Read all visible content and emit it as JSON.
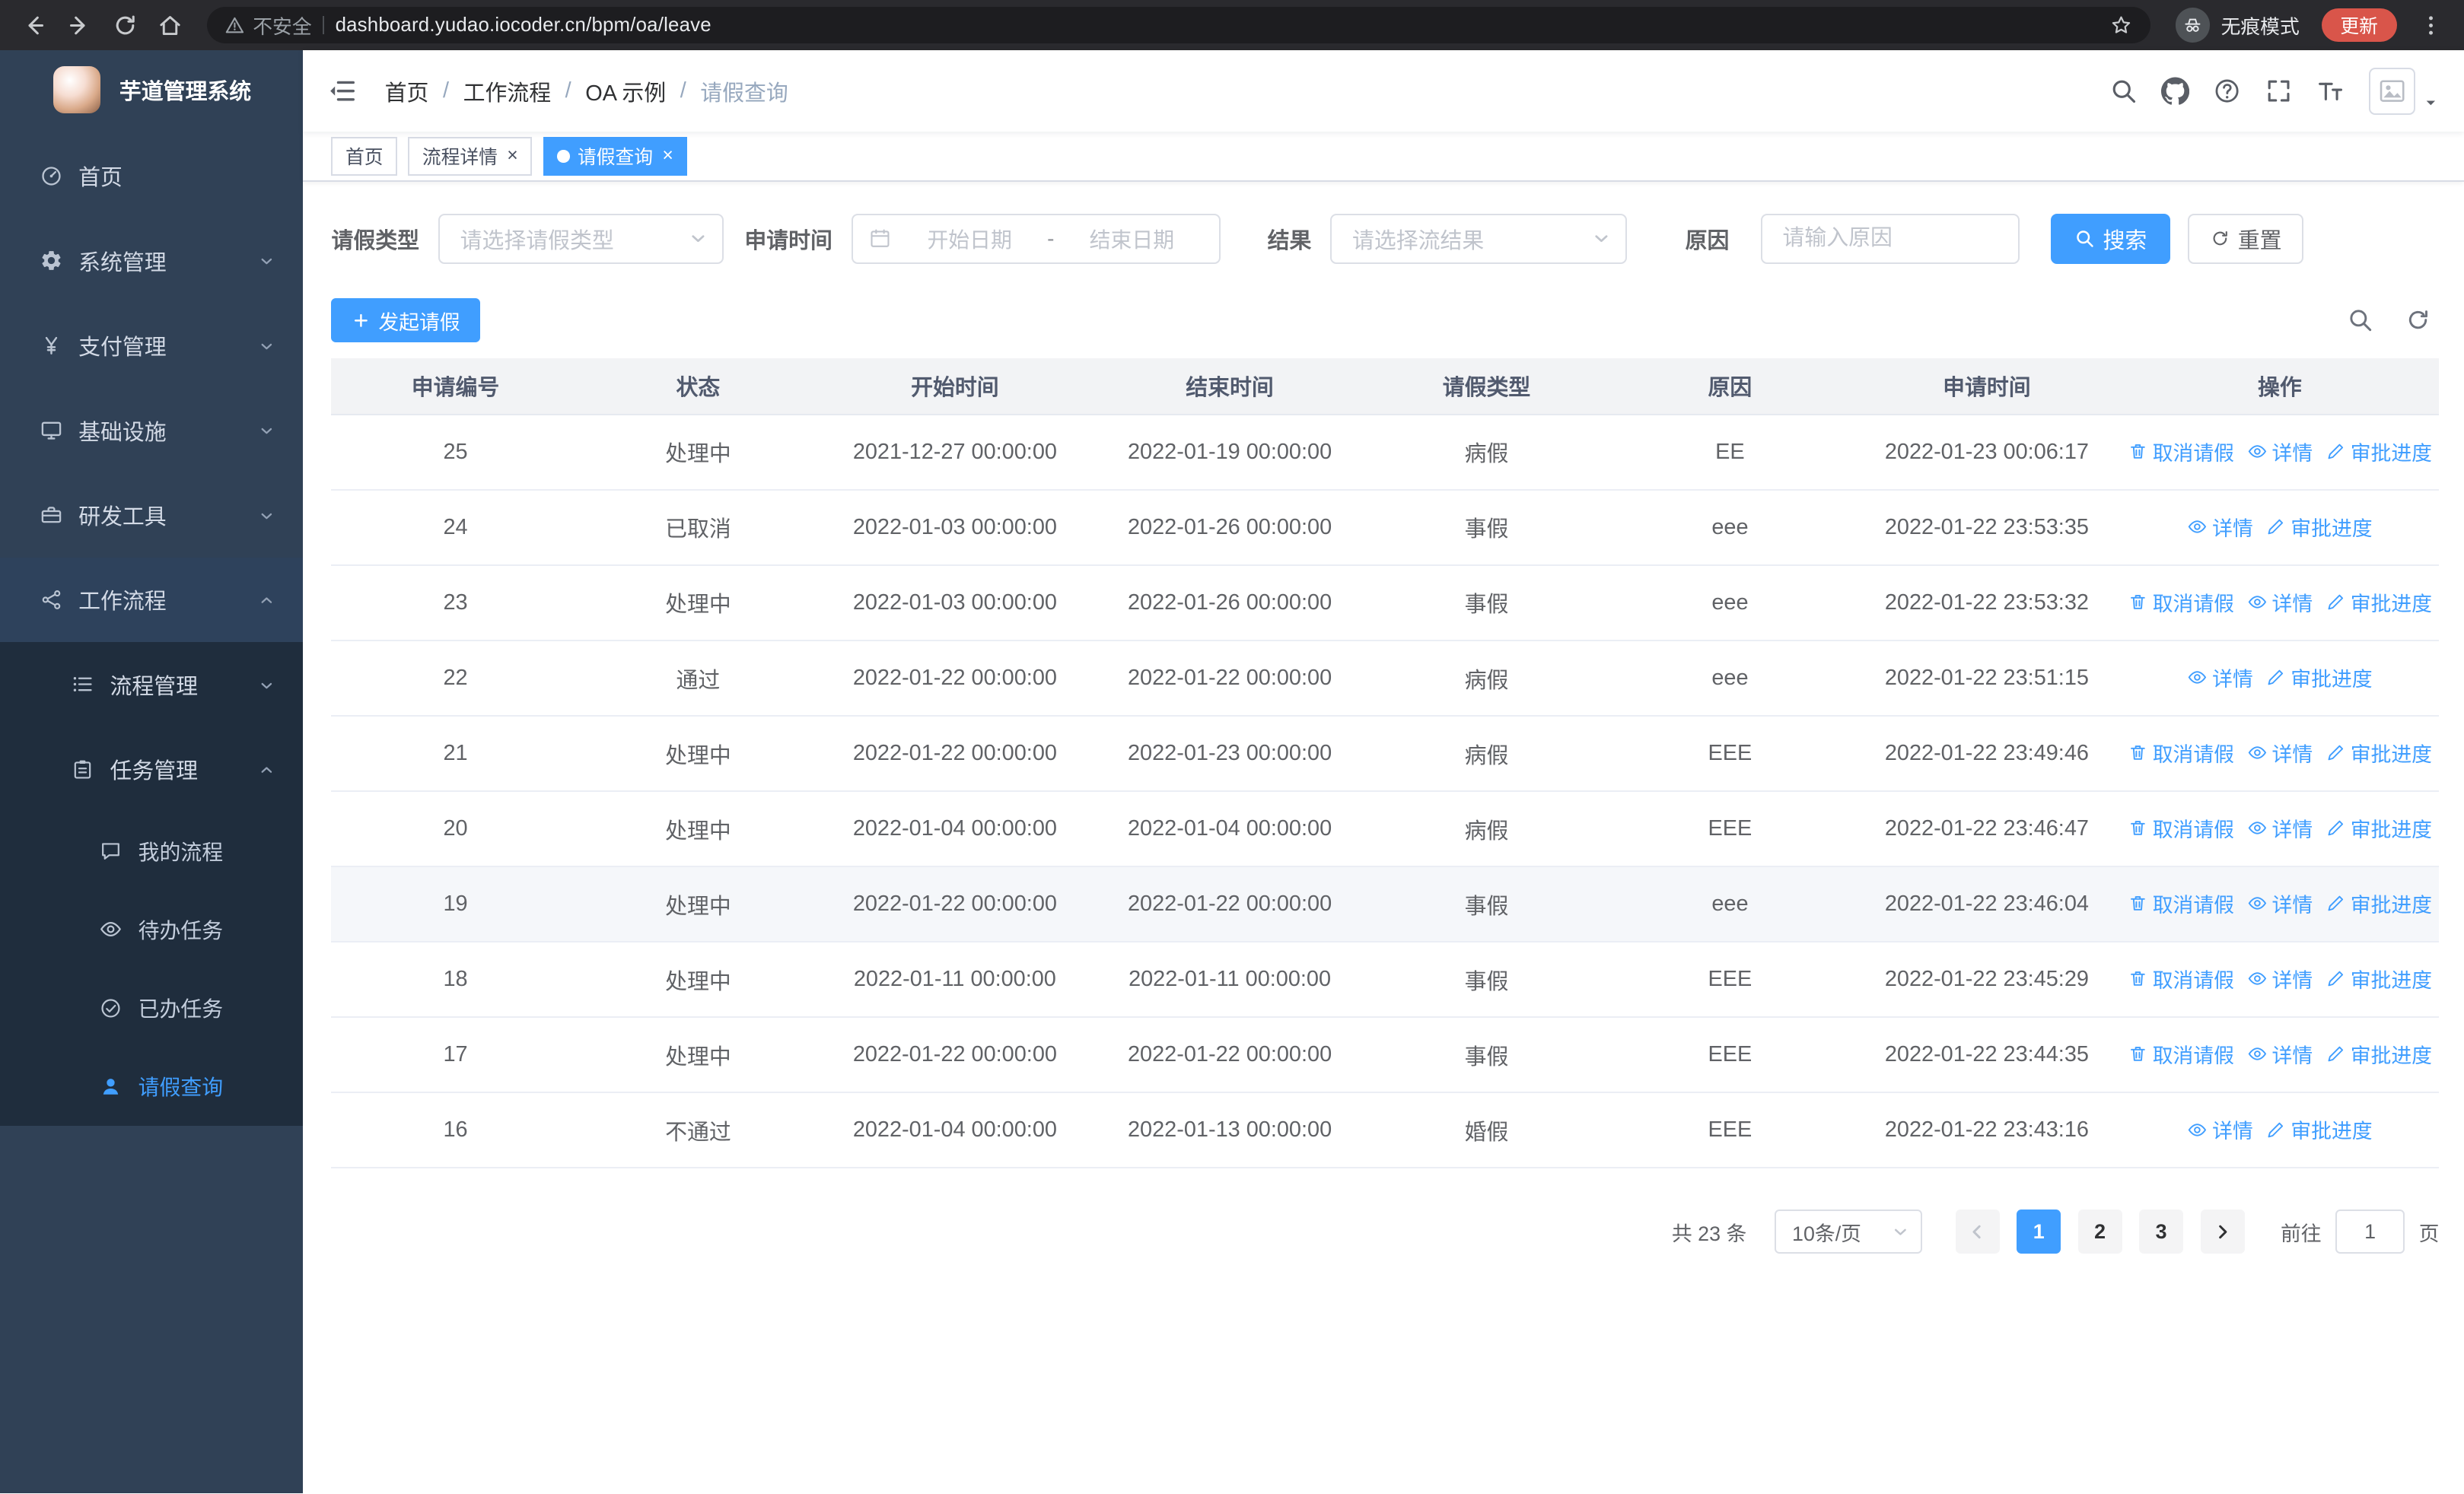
{
  "colors": {
    "primary": "#409eff",
    "sidebar_bg": "#304156",
    "sidebar_submenu_bg": "#1f2d3d",
    "chrome_bg": "#2a2a2e",
    "table_header_bg": "#f2f3f5"
  },
  "browser": {
    "security_label": "不安全",
    "url": "dashboard.yudao.iocoder.cn/bpm/oa/leave",
    "incognito_label": "无痕模式",
    "update_label": "更新"
  },
  "sidebar": {
    "title": "芋道管理系统",
    "menu": [
      {
        "label": "首页"
      },
      {
        "label": "系统管理"
      },
      {
        "label": "支付管理"
      },
      {
        "label": "基础设施"
      },
      {
        "label": "研发工具"
      },
      {
        "label": "工作流程",
        "expanded": true,
        "children": [
          {
            "label": "流程管理"
          },
          {
            "label": "任务管理",
            "expanded": true,
            "children": [
              {
                "label": "我的流程"
              },
              {
                "label": "待办任务"
              },
              {
                "label": "已办任务"
              },
              {
                "label": "请假查询",
                "active": true
              }
            ]
          }
        ]
      }
    ]
  },
  "breadcrumb": {
    "separator": "/",
    "items": [
      "首页",
      "工作流程",
      "OA 示例",
      "请假查询"
    ]
  },
  "tabs": [
    {
      "label": "首页",
      "active": false,
      "closable": false
    },
    {
      "label": "流程详情",
      "active": false,
      "closable": true
    },
    {
      "label": "请假查询",
      "active": true,
      "closable": true
    }
  ],
  "filters": {
    "type_label": "请假类型",
    "type_placeholder": "请选择请假类型",
    "time_label": "申请时间",
    "time_start_placeholder": "开始日期",
    "time_separator": "-",
    "time_end_placeholder": "结束日期",
    "result_label": "结果",
    "result_placeholder": "请选择流结果",
    "reason_label": "原因",
    "reason_placeholder": "请输入原因",
    "search_label": "搜索",
    "reset_label": "重置"
  },
  "toolbar": {
    "create_label": "发起请假"
  },
  "table": {
    "columns": [
      "申请编号",
      "状态",
      "开始时间",
      "结束时间",
      "请假类型",
      "原因",
      "申请时间",
      "操作"
    ],
    "column_keys": [
      "id",
      "status",
      "start",
      "end",
      "type",
      "reason",
      "applied"
    ],
    "action_labels": {
      "cancel": "取消请假",
      "detail": "详情",
      "progress": "审批进度"
    },
    "rows": [
      {
        "id": "25",
        "status": "处理中",
        "start": "2021-12-27 00:00:00",
        "end": "2022-01-19 00:00:00",
        "type": "病假",
        "reason": "EE",
        "applied": "2022-01-23 00:06:17",
        "cancelable": true,
        "highlighted": false
      },
      {
        "id": "24",
        "status": "已取消",
        "start": "2022-01-03 00:00:00",
        "end": "2022-01-26 00:00:00",
        "type": "事假",
        "reason": "eee",
        "applied": "2022-01-22 23:53:35",
        "cancelable": false,
        "highlighted": false
      },
      {
        "id": "23",
        "status": "处理中",
        "start": "2022-01-03 00:00:00",
        "end": "2022-01-26 00:00:00",
        "type": "事假",
        "reason": "eee",
        "applied": "2022-01-22 23:53:32",
        "cancelable": true,
        "highlighted": false
      },
      {
        "id": "22",
        "status": "通过",
        "start": "2022-01-22 00:00:00",
        "end": "2022-01-22 00:00:00",
        "type": "病假",
        "reason": "eee",
        "applied": "2022-01-22 23:51:15",
        "cancelable": false,
        "highlighted": false
      },
      {
        "id": "21",
        "status": "处理中",
        "start": "2022-01-22 00:00:00",
        "end": "2022-01-23 00:00:00",
        "type": "病假",
        "reason": "EEE",
        "applied": "2022-01-22 23:49:46",
        "cancelable": true,
        "highlighted": false
      },
      {
        "id": "20",
        "status": "处理中",
        "start": "2022-01-04 00:00:00",
        "end": "2022-01-04 00:00:00",
        "type": "病假",
        "reason": "EEE",
        "applied": "2022-01-22 23:46:47",
        "cancelable": true,
        "highlighted": false
      },
      {
        "id": "19",
        "status": "处理中",
        "start": "2022-01-22 00:00:00",
        "end": "2022-01-22 00:00:00",
        "type": "事假",
        "reason": "eee",
        "applied": "2022-01-22 23:46:04",
        "cancelable": true,
        "highlighted": true
      },
      {
        "id": "18",
        "status": "处理中",
        "start": "2022-01-11 00:00:00",
        "end": "2022-01-11 00:00:00",
        "type": "事假",
        "reason": "EEE",
        "applied": "2022-01-22 23:45:29",
        "cancelable": true,
        "highlighted": false
      },
      {
        "id": "17",
        "status": "处理中",
        "start": "2022-01-22 00:00:00",
        "end": "2022-01-22 00:00:00",
        "type": "事假",
        "reason": "EEE",
        "applied": "2022-01-22 23:44:35",
        "cancelable": true,
        "highlighted": false
      },
      {
        "id": "16",
        "status": "不通过",
        "start": "2022-01-04 00:00:00",
        "end": "2022-01-13 00:00:00",
        "type": "婚假",
        "reason": "EEE",
        "applied": "2022-01-22 23:43:16",
        "cancelable": false,
        "highlighted": false
      }
    ]
  },
  "pagination": {
    "total_label": "共 23 条",
    "page_size_label": "10条/页",
    "pages": [
      "1",
      "2",
      "3"
    ],
    "active_page": "1",
    "goto_label": "前往",
    "goto_value": "1",
    "unit_label": "页"
  }
}
